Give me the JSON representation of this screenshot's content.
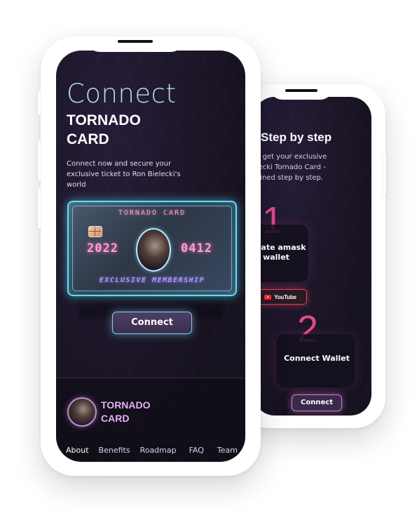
{
  "steps_screen": {
    "title": "Step by step",
    "description": "w to get your exclusive Bielecki Tornado Card - xplained step by step.",
    "step1": {
      "number": "1",
      "label": "Create amask wallet",
      "button": "YouTube"
    },
    "step2": {
      "number": "2",
      "label": "Connect Wallet",
      "button": "Connect"
    }
  },
  "main_screen": {
    "heading_light": "Connect",
    "heading_bold": "TORNADO CARD",
    "description": "Connect now and secure your exclusive ticket to Ron Bielecki's world",
    "card": {
      "title": "TORNADO CARD",
      "year": "2022",
      "code": "0412",
      "tagline": "EXCLUSIVE MEMBERSHIP"
    },
    "connect_button": "Connect",
    "footer": {
      "brand_line1": "TORNADO",
      "brand_line2": "CARD",
      "nav": [
        "About",
        "Benefits",
        "Roadmap",
        "FAQ",
        "Team"
      ]
    }
  },
  "colors": {
    "screen_bg": "#1b1528",
    "accent_cyan": "#5ae0ff",
    "accent_pink": "#e14a8a",
    "accent_purple": "#d77ad0"
  }
}
